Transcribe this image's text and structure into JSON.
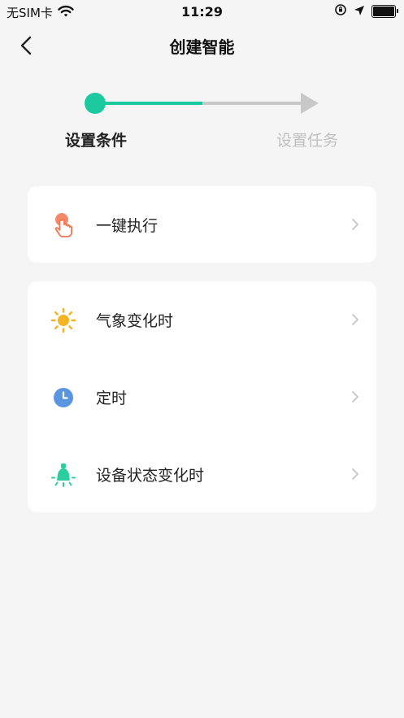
{
  "status_bar": {
    "carrier": "无SIM卡",
    "time": "11:29"
  },
  "nav": {
    "title": "创建智能"
  },
  "stepper": {
    "steps": [
      {
        "label": "设置条件",
        "active": true
      },
      {
        "label": "设置任务",
        "active": false
      }
    ],
    "accent_color": "#1dc99f",
    "inactive_color": "#c8c8c8"
  },
  "groups": [
    {
      "items": [
        {
          "label": "一键执行",
          "icon": "tap-hand-icon",
          "icon_color": "#f07650"
        }
      ]
    },
    {
      "items": [
        {
          "label": "气象变化时",
          "icon": "sun-icon",
          "icon_color": "#f5b320"
        },
        {
          "label": "定时",
          "icon": "clock-icon",
          "icon_color": "#5a95e0"
        },
        {
          "label": "设备状态变化时",
          "icon": "bulb-icon",
          "icon_color": "#2bcf9f"
        }
      ]
    }
  ]
}
